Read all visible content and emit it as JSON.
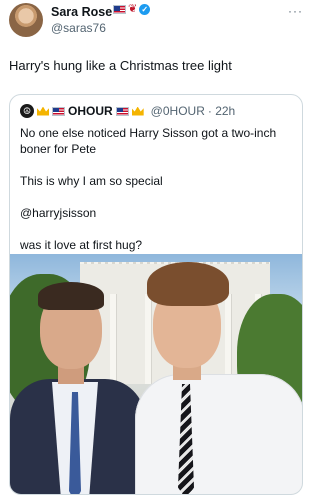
{
  "author": {
    "name": "Sara Rose",
    "handle": "@saras76",
    "badges": [
      "us-flag-icon",
      "rose-icon",
      "verified-badge-icon"
    ]
  },
  "tweet": {
    "text": "Harry's hung like a Christmas tree light"
  },
  "more_label": "···",
  "quote": {
    "name": "OHOUR",
    "handle": "@0HOUR",
    "time": "· 22h",
    "lines": [
      "No one else noticed Harry Sisson got a two-inch",
      "boner for Pete",
      "This is why I am so special",
      "@harryjsisson",
      "was it love at first hug?"
    ]
  },
  "colors": {
    "text": "#0f1419",
    "secondary": "#536471",
    "border": "#cfd9de",
    "verified": "#1d9bf0"
  }
}
